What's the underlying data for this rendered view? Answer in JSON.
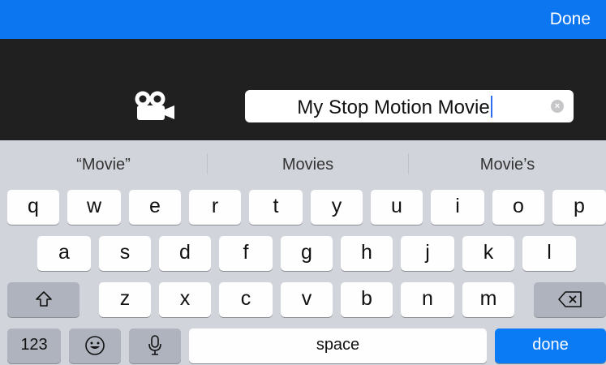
{
  "top_bar": {
    "done_label": "Done"
  },
  "editor": {
    "title_value": "My Stop Motion Movie"
  },
  "suggestions": [
    "“Movie”",
    "Movies",
    "Movie’s"
  ],
  "keyboard": {
    "row1": [
      "q",
      "w",
      "e",
      "r",
      "t",
      "y",
      "u",
      "i",
      "o",
      "p"
    ],
    "row2": [
      "a",
      "s",
      "d",
      "f",
      "g",
      "h",
      "j",
      "k",
      "l"
    ],
    "row3": [
      "z",
      "x",
      "c",
      "v",
      "b",
      "n",
      "m"
    ],
    "numbers_label": "123",
    "space_label": "space",
    "done_label": "done"
  },
  "icons": [
    "camera-icon",
    "clear-text-icon",
    "shift-icon",
    "backspace-icon",
    "emoji-icon",
    "microphone-icon"
  ],
  "colors": {
    "accent": "#0c76f0",
    "header_bg": "#202020",
    "keyboard_bg": "#d1d4da",
    "special_key": "#aeb3bd",
    "done_key": "#0a7bf5"
  }
}
